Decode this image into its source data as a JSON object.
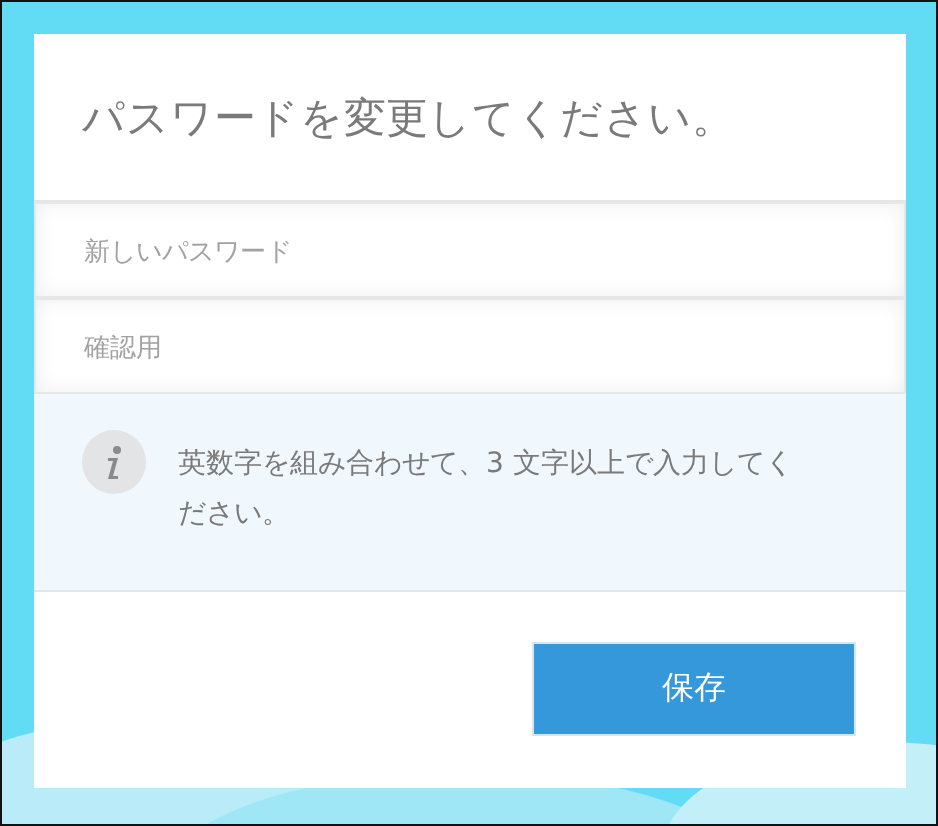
{
  "dialog": {
    "title": "パスワードを変更してください。"
  },
  "fields": [
    {
      "placeholder": "新しいパスワード"
    },
    {
      "placeholder": "確認用"
    }
  ],
  "info": {
    "text": "英数字を組み合わせて、3 文字以上で入力してください。"
  },
  "buttons": [
    {
      "label": "保存"
    }
  ]
}
